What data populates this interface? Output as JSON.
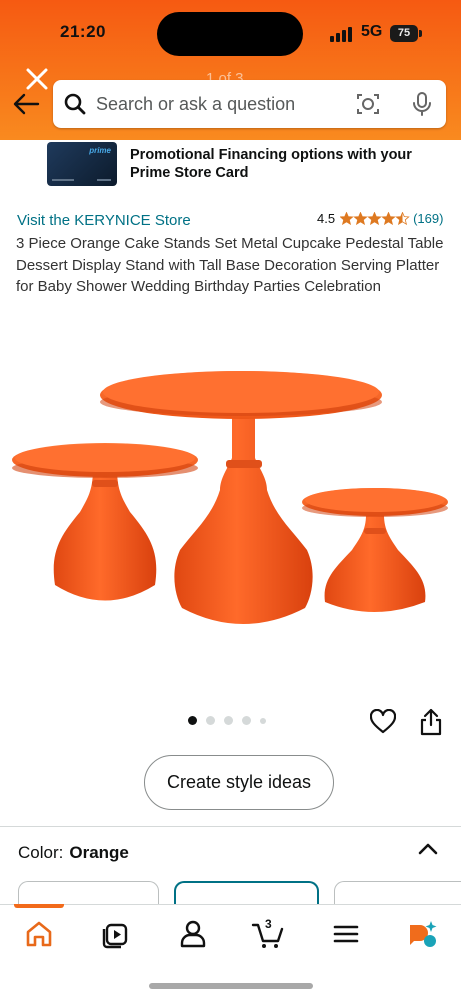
{
  "status_bar": {
    "time": "21:20",
    "network": "5G",
    "battery": "75"
  },
  "header": {
    "pager_text": "1 of 3",
    "search_placeholder": "Search or ask a question",
    "accent_color": "#f77419"
  },
  "promo": {
    "text": "Promotional Financing options with your Prime Store Card",
    "card_brand": "prime"
  },
  "product": {
    "store_link": "Visit the KERYNICE Store",
    "rating": "4.5",
    "stars": 4.5,
    "review_count": "(169)",
    "title": "3 Piece Orange Cake Stands Set Metal Cupcake Pedestal Table Dessert Display Stand with Tall Base Decoration Serving Platter for Baby Shower Wedding Birthday Parties Celebration",
    "image_color": "#f05a1c"
  },
  "gallery": {
    "dot_count": 5,
    "active_index": 0
  },
  "actions": {
    "style_button": "Create style ideas"
  },
  "variant": {
    "label": "Color:",
    "value": "Orange"
  },
  "bottom_nav": {
    "items": [
      "home-icon",
      "play-icon",
      "account-icon",
      "cart-icon",
      "menu-icon",
      "rufus-icon"
    ],
    "cart_count": "3",
    "active": "home-icon"
  }
}
